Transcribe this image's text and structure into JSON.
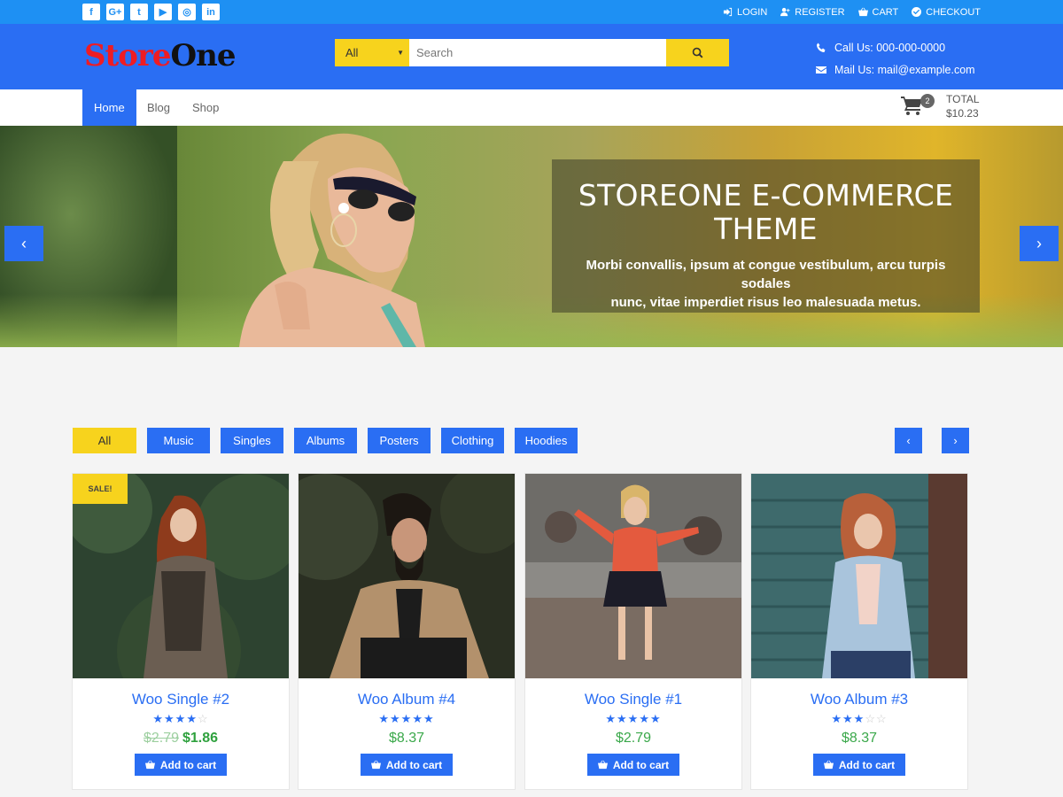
{
  "topbar": {
    "social": [
      {
        "icon": "facebook-icon",
        "glyph": "f"
      },
      {
        "icon": "google-plus-icon",
        "glyph": "G+"
      },
      {
        "icon": "twitter-icon",
        "glyph": "t"
      },
      {
        "icon": "youtube-icon",
        "glyph": "▶"
      },
      {
        "icon": "instagram-icon",
        "glyph": "◎"
      },
      {
        "icon": "linkedin-icon",
        "glyph": "in"
      }
    ],
    "links": {
      "login": "LOGIN",
      "register": "REGISTER",
      "cart": "CART",
      "checkout": "CHECKOUT"
    }
  },
  "header": {
    "logo_part1": "Store",
    "logo_part2": "One",
    "search": {
      "category": "All",
      "placeholder": "Search"
    },
    "contact": {
      "phone": "Call Us: 000-000-0000",
      "mail": "Mail Us: mail@example.com"
    }
  },
  "nav": {
    "items": [
      {
        "label": "Home",
        "active": true
      },
      {
        "label": "Blog",
        "active": false
      },
      {
        "label": "Shop",
        "active": false
      }
    ],
    "cart_count": "2",
    "total_label": "TOTAL",
    "total_value": "$10.23"
  },
  "hero": {
    "title_line1": "STOREONE E-COMMERCE",
    "title_line2": "THEME",
    "text_line1": "Morbi convallis, ipsum at congue vestibulum, arcu turpis sodales",
    "text_line2": "nunc, vitae imperdiet risus leo malesuada metus.",
    "prev": "‹",
    "next": "›"
  },
  "filters": [
    "All",
    "Music",
    "Singles",
    "Albums",
    "Posters",
    "Clothing",
    "Hoodies"
  ],
  "filter_active": "All",
  "products": [
    {
      "name": "Woo Single #2",
      "rating": 4.5,
      "old_price": "$2.79",
      "price": "$1.86",
      "sale": "SALE!",
      "button": "Add to cart"
    },
    {
      "name": "Woo Album #4",
      "rating": 5,
      "old_price": "",
      "price": "$8.37",
      "sale": "",
      "button": "Add to cart"
    },
    {
      "name": "Woo Single #1",
      "rating": 5,
      "old_price": "",
      "price": "$2.79",
      "sale": "",
      "button": "Add to cart"
    },
    {
      "name": "Woo Album #3",
      "rating": 3,
      "old_price": "",
      "price": "$8.37",
      "sale": "",
      "button": "Add to cart"
    }
  ],
  "colors": {
    "topbar": "#1e90f3",
    "primary": "#2a6ef3",
    "accent_yellow": "#f7d31d",
    "price_green": "#2fa13e"
  }
}
